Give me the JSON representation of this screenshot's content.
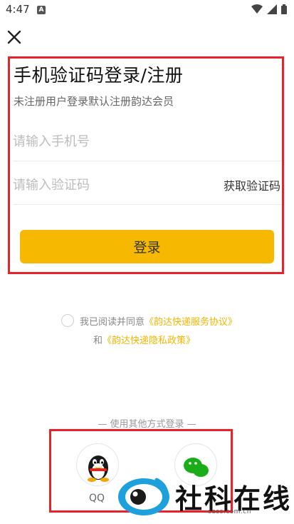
{
  "status_bar": {
    "time": "4:47",
    "notif_letter": "A"
  },
  "header": {
    "close_icon": "close-icon"
  },
  "login": {
    "title": "手机验证码登录/注册",
    "subtitle": "未注册用户登录默认注册韵达会员",
    "phone_placeholder": "请输入手机号",
    "phone_value": "",
    "code_placeholder": "请输入验证码",
    "code_value": "",
    "get_code_label": "获取验证码",
    "login_label": "登录"
  },
  "agreement": {
    "prefix": "我已阅读并同意",
    "service_link": "《韵达快递服务协议》",
    "and_text": "和",
    "privacy_link": "《韵达快递隐私政策》"
  },
  "other_login": {
    "divider_text": "— 使用其他方式登录 —",
    "qq_label": "QQ"
  },
  "watermark": {
    "text": "社科在线",
    "url": "cass.com.cn"
  },
  "colors": {
    "accent": "#f6b800",
    "highlight": "#e8212b",
    "link": "#f0b400",
    "wechat": "#1aad19"
  }
}
